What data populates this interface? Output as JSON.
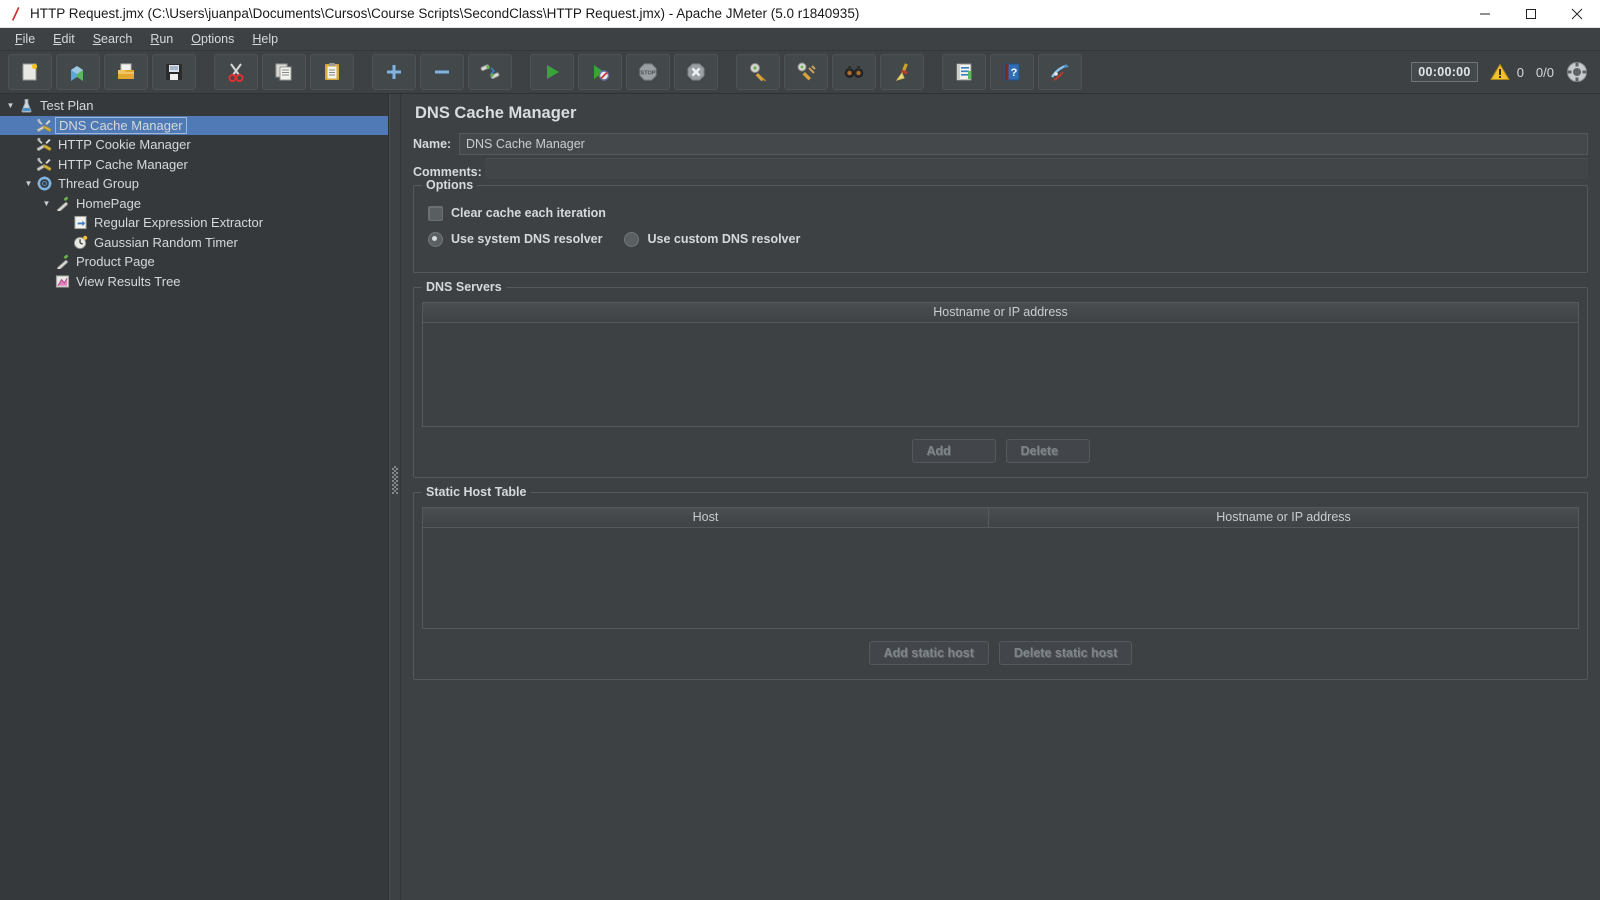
{
  "window": {
    "title": "HTTP Request.jmx (C:\\Users\\juanpa\\Documents\\Cursos\\Course Scripts\\SecondClass\\HTTP Request.jmx) - Apache JMeter (5.0 r1840935)",
    "minimize": "—",
    "maximize": "☐",
    "close": "✕"
  },
  "menubar": {
    "items": [
      {
        "mnemonic": "F",
        "rest": "ile"
      },
      {
        "mnemonic": "E",
        "rest": "dit"
      },
      {
        "mnemonic": "S",
        "rest": "earch"
      },
      {
        "mnemonic": "R",
        "rest": "un"
      },
      {
        "mnemonic": "O",
        "rest": "ptions"
      },
      {
        "mnemonic": "H",
        "rest": "elp"
      }
    ]
  },
  "toolbar": {
    "buttons": [
      {
        "name": "new-icon",
        "title": "New"
      },
      {
        "name": "templates-icon",
        "title": "Templates"
      },
      {
        "name": "open-icon",
        "title": "Open"
      },
      {
        "name": "save-icon",
        "title": "Save"
      },
      {
        "name": "cut-icon",
        "title": "Cut"
      },
      {
        "name": "copy-icon",
        "title": "Copy"
      },
      {
        "name": "paste-icon",
        "title": "Paste"
      },
      {
        "name": "expand-icon",
        "title": "Expand All"
      },
      {
        "name": "collapse-icon",
        "title": "Collapse All"
      },
      {
        "name": "toggle-icon",
        "title": "Toggle"
      },
      {
        "name": "start-icon",
        "title": "Start"
      },
      {
        "name": "start-no-pauses-icon",
        "title": "Start no pauses"
      },
      {
        "name": "stop-icon",
        "title": "Stop"
      },
      {
        "name": "shutdown-icon",
        "title": "Shutdown"
      },
      {
        "name": "clear-icon",
        "title": "Clear"
      },
      {
        "name": "clear-all-icon",
        "title": "Clear All"
      },
      {
        "name": "search-icon",
        "title": "Search"
      },
      {
        "name": "reset-search-icon",
        "title": "Reset Search"
      },
      {
        "name": "function-helper-icon",
        "title": "Function Helper Dialog"
      },
      {
        "name": "help-icon",
        "title": "Help"
      },
      {
        "name": "undo-redo-icon",
        "title": "Undo"
      }
    ],
    "status": {
      "timer": "00:00:00",
      "warnings": "0",
      "threads": "0/0"
    }
  },
  "tree": {
    "nodes": [
      {
        "label": "Test Plan",
        "indent": 0,
        "twisty": "▼",
        "icon": "test-plan-icon",
        "selected": false
      },
      {
        "label": "DNS Cache Manager",
        "indent": 1,
        "twisty": "",
        "icon": "config-element-icon",
        "selected": true
      },
      {
        "label": "HTTP Cookie Manager",
        "indent": 1,
        "twisty": "",
        "icon": "config-element-icon",
        "selected": false
      },
      {
        "label": "HTTP Cache Manager",
        "indent": 1,
        "twisty": "",
        "icon": "config-element-icon",
        "selected": false
      },
      {
        "label": "Thread Group",
        "indent": 1,
        "twisty": "▼",
        "icon": "thread-group-icon",
        "selected": false
      },
      {
        "label": "HomePage",
        "indent": 2,
        "twisty": "▼",
        "icon": "sampler-icon",
        "selected": false
      },
      {
        "label": "Regular Expression Extractor",
        "indent": 3,
        "twisty": "",
        "icon": "post-processor-icon",
        "selected": false
      },
      {
        "label": "Gaussian Random Timer",
        "indent": 3,
        "twisty": "",
        "icon": "timer-icon",
        "selected": false
      },
      {
        "label": "Product Page",
        "indent": 2,
        "twisty": "",
        "icon": "sampler-icon",
        "selected": false
      },
      {
        "label": "View Results Tree",
        "indent": 2,
        "twisty": "",
        "icon": "listener-icon",
        "selected": false
      }
    ]
  },
  "panel": {
    "title": "DNS Cache Manager",
    "name_label": "Name:",
    "name_value": "DNS Cache Manager",
    "comments_label": "Comments:",
    "comments_value": "",
    "options": {
      "legend": "Options",
      "clear_cache_label": "Clear cache each iteration",
      "clear_cache_checked": false,
      "system_resolver_label": "Use system DNS resolver",
      "system_resolver_selected": true,
      "custom_resolver_label": "Use custom DNS resolver",
      "custom_resolver_selected": false
    },
    "dns_servers": {
      "legend": "DNS Servers",
      "columns": [
        "Hostname or IP address"
      ],
      "rows": [],
      "add_label": "Add",
      "delete_label": "Delete"
    },
    "static_host_table": {
      "legend": "Static Host Table",
      "columns": [
        "Host",
        "Hostname or IP address"
      ],
      "rows": [],
      "add_label": "Add static host",
      "delete_label": "Delete static host"
    }
  },
  "colors": {
    "background": "#3d4144",
    "tree_background": "#35393c",
    "selection": "#4f7ab5",
    "text": "#d6d9db",
    "border": "#55595c",
    "titlebar": "#ffffff"
  }
}
